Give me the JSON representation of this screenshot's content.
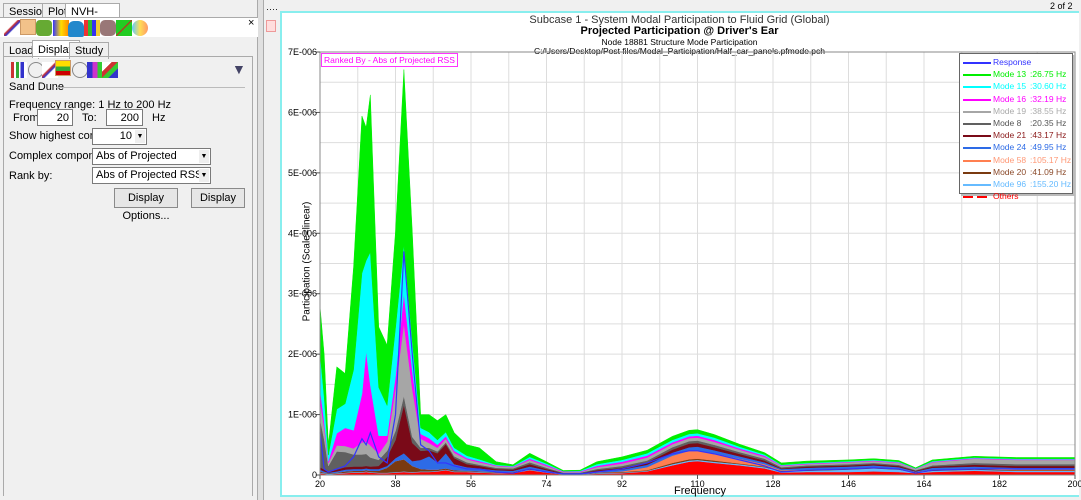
{
  "menu_tabs": [
    "Session",
    "Plot",
    "NVH-Utilities"
  ],
  "sub_tabs": [
    "Load",
    "Display",
    "Study"
  ],
  "panel": {
    "section": "Sand Dune",
    "freq_range": "Frequency range: 1 Hz to 200 Hz",
    "from_label": "From:",
    "from_value": "20",
    "to_label": "To:",
    "to_value": "200",
    "unit": "Hz",
    "highest_label": "Show highest contrib:",
    "highest_value": "10",
    "complex_label": "Complex component:",
    "complex_value": "Abs of Projected",
    "rank_label": "Rank by:",
    "rank_value": "Abs of Projected RSS",
    "display_options": "Display Options...",
    "display": "Display"
  },
  "page_indicator": "2 of 2",
  "chart_data": {
    "type": "area",
    "title": "Subcase 1 - System Modal Participation to Fluid Grid (Global)",
    "subtitle": "Projected Participation @ Driver's Ear",
    "subtitle2": "Node 18881 Structure Mode Participation",
    "file": "C:/Users/Desktop/Post files/Modal_Participation/Half_car_panels.pfmode.pch",
    "annotation": "Ranked By - Abs of Projected RSS",
    "xlabel": "Frequency",
    "ylabel": "Participation (Scale=linear)",
    "xlim": [
      20,
      200
    ],
    "ylim": [
      0,
      7e-06
    ],
    "y_unit_scale": 1e-07,
    "xticks": [
      "20",
      "38",
      "56",
      "74",
      "92",
      "110",
      "128",
      "146",
      "164",
      "182",
      "200"
    ],
    "yticks": [
      "0",
      "1E-006",
      "2E-006",
      "3E-006",
      "4E-006",
      "5E-006",
      "6E-006",
      "7E-006"
    ],
    "legend_position": "top-right",
    "x": [
      20,
      21,
      22,
      24,
      26,
      28,
      30,
      31,
      32,
      34,
      36,
      38,
      40,
      42,
      44,
      46,
      48,
      50,
      52,
      55,
      58,
      62,
      66,
      70,
      74,
      78,
      82,
      86,
      92,
      98,
      104,
      108,
      110,
      114,
      120,
      126,
      130,
      136,
      146,
      152,
      158,
      162,
      166,
      176,
      186,
      200
    ],
    "response": {
      "name": "Response",
      "color": "#3333ff",
      "values": [
        7,
        1,
        0.5,
        1,
        1.5,
        3,
        6,
        5,
        7,
        3,
        2,
        10,
        37,
        20,
        5,
        4,
        2,
        2,
        1.5,
        1,
        1,
        0.5,
        0.3,
        1,
        0.5,
        0.2,
        0.2,
        0.5,
        1,
        2,
        3.5,
        4,
        4,
        3.5,
        2.5,
        1.5,
        0.5,
        0.8,
        1,
        1.2,
        1,
        0.3,
        0.8,
        1,
        1,
        1
      ]
    },
    "series": [
      {
        "name": "Others",
        "freq": "",
        "color": "#ff0000",
        "values": [
          0.3,
          0.2,
          0.1,
          0.2,
          0.3,
          0.4,
          0.4,
          0.5,
          0.4,
          0.3,
          0.3,
          0.4,
          0.5,
          0.4,
          0.5,
          0.5,
          0.6,
          0.8,
          0.5,
          0.5,
          0.4,
          0.3,
          0.3,
          0.8,
          0.4,
          0.1,
          0.1,
          0.2,
          0.3,
          0.6,
          1.6,
          2.2,
          2.3,
          2.0,
          1.6,
          1.1,
          0.4,
          0.5,
          0.5,
          0.6,
          0.5,
          0.3,
          0.5,
          0.7,
          0.5,
          0.5
        ]
      },
      {
        "name": "Mode 96",
        "freq": ":155.20 Hz",
        "color": "#66bbff",
        "values": [
          0.1,
          0.1,
          0.1,
          0.1,
          0.1,
          0.1,
          0.1,
          0.1,
          0.1,
          0.1,
          0.1,
          0.1,
          0.1,
          0.1,
          0.1,
          0.1,
          0.1,
          0.1,
          0.1,
          0.1,
          0.1,
          0.1,
          0.1,
          0.1,
          0.1,
          0,
          0,
          0.1,
          0.1,
          0.1,
          0.2,
          0.2,
          0.2,
          0.2,
          0.2,
          0.2,
          0.2,
          0.2,
          0.4,
          0.5,
          0.4,
          0.1,
          0.2,
          0.2,
          0.2,
          0.2
        ]
      },
      {
        "name": "Mode 20",
        "freq": ":41.09 Hz",
        "color": "#7a3a10",
        "values": [
          0.2,
          0.1,
          0.1,
          0.1,
          0.2,
          0.2,
          0.2,
          0.2,
          0.2,
          0.3,
          0.8,
          1.8,
          2.0,
          1.0,
          0.4,
          0.3,
          0.2,
          0.2,
          0.2,
          0.1,
          0.1,
          0.1,
          0.1,
          0.2,
          0.1,
          0,
          0,
          0.1,
          0.1,
          0.1,
          0.2,
          0.2,
          0.2,
          0.2,
          0.1,
          0.1,
          0.1,
          0.1,
          0.1,
          0.1,
          0.1,
          0.1,
          0.1,
          0.1,
          0.1,
          0.1
        ]
      },
      {
        "name": "Mode 58",
        "freq": ":105.17 Hz",
        "color": "#ff7f50",
        "values": [
          0,
          0,
          0,
          0,
          0,
          0,
          0,
          0,
          0,
          0,
          0,
          0,
          0,
          0,
          0,
          0,
          0,
          0,
          0,
          0,
          0,
          0,
          0,
          0,
          0,
          0,
          0,
          0,
          0.1,
          0.5,
          1.2,
          1.4,
          1.4,
          1.2,
          0.8,
          0.4,
          0.1,
          0.1,
          0.1,
          0.1,
          0.1,
          0,
          0.1,
          0.1,
          0.1,
          0.1
        ]
      },
      {
        "name": "Mode 24",
        "freq": ":49.95 Hz",
        "color": "#2d6be6",
        "values": [
          0.3,
          0.2,
          0.1,
          0.2,
          0.3,
          0.3,
          0.3,
          0.3,
          0.3,
          0.3,
          0.3,
          0.5,
          1.0,
          0.8,
          1.5,
          2.2,
          1.2,
          2.5,
          1.0,
          0.6,
          0.5,
          0.3,
          0.2,
          0.3,
          0.2,
          0.1,
          0.1,
          0.2,
          0.3,
          0.4,
          0.5,
          0.6,
          0.6,
          0.5,
          0.4,
          0.3,
          0.2,
          0.3,
          0.3,
          0.3,
          0.2,
          0.1,
          0.3,
          0.3,
          0.3,
          0.3
        ]
      },
      {
        "name": "Mode 21",
        "freq": ":43.17 Hz",
        "color": "#7a0a18",
        "values": [
          0.4,
          0.3,
          0.1,
          0.3,
          0.4,
          0.4,
          0.4,
          0.4,
          0.4,
          0.5,
          1.5,
          3.0,
          8.0,
          3.0,
          1.5,
          1.0,
          1.5,
          1.5,
          1.0,
          0.5,
          0.4,
          0.2,
          0.2,
          0.4,
          0.2,
          0.1,
          0.1,
          0.2,
          0.3,
          0.4,
          0.5,
          0.6,
          0.6,
          0.5,
          0.4,
          0.3,
          0.1,
          0.2,
          0.2,
          0.2,
          0.2,
          0.1,
          0.2,
          0.3,
          0.3,
          0.3
        ]
      },
      {
        "name": "Mode 8",
        "freq": ":20.35 Hz",
        "color": "#606060",
        "values": [
          8,
          5,
          1,
          3,
          2.5,
          2,
          2,
          2,
          1.5,
          1,
          1,
          1.5,
          1.5,
          1,
          0.5,
          0.4,
          0.3,
          0.3,
          0.3,
          0.3,
          0.2,
          0.2,
          0.2,
          0.3,
          0.2,
          0.1,
          0.1,
          0.2,
          0.3,
          0.3,
          0.4,
          0.4,
          0.4,
          0.4,
          0.3,
          0.3,
          0.2,
          0.2,
          0.2,
          0.2,
          0.2,
          0.1,
          0.2,
          0.3,
          0.3,
          0.3
        ]
      },
      {
        "name": "Mode 19",
        "freq": ":38.55 Hz",
        "color": "#a6a6a6",
        "values": [
          3,
          2,
          0.5,
          1,
          1,
          1,
          2,
          2,
          2,
          1,
          1.5,
          7,
          12,
          8,
          1.5,
          0.8,
          0.6,
          0.6,
          0.6,
          0.5,
          0.4,
          0.3,
          0.2,
          0.4,
          0.3,
          0.1,
          0.1,
          0.3,
          0.4,
          0.5,
          0.5,
          0.5,
          0.5,
          0.5,
          0.4,
          0.3,
          0.2,
          0.2,
          0.3,
          0.3,
          0.3,
          0.2,
          0.5,
          0.7,
          0.7,
          0.7
        ]
      },
      {
        "name": "Mode 16",
        "freq": ":32.19 Hz",
        "color": "#ff00ff",
        "values": [
          2,
          1,
          0.3,
          2,
          3,
          3,
          8,
          15,
          10,
          3,
          1,
          2,
          5,
          3,
          0.8,
          0.8,
          0.5,
          0.4,
          0.3,
          0.2,
          0.2,
          0.1,
          0.1,
          0.2,
          0.2,
          0.1,
          0.1,
          0.2,
          0.3,
          0.3,
          0.3,
          0.3,
          0.3,
          0.3,
          0.2,
          0.2,
          0.1,
          0.1,
          0.1,
          0.1,
          0.1,
          0.05,
          0.1,
          0.1,
          0.1,
          0.1
        ]
      },
      {
        "name": "Mode 15",
        "freq": ":30.60 Hz",
        "color": "#00ffff",
        "values": [
          6,
          4,
          1,
          4,
          4,
          10,
          20,
          15,
          22,
          8,
          5,
          8,
          8,
          5,
          1,
          1,
          0.8,
          0.7,
          0.5,
          0.4,
          0.3,
          0.1,
          0.1,
          0.3,
          0.2,
          0.05,
          0.1,
          0.3,
          0.3,
          0.4,
          0.4,
          0.4,
          0.4,
          0.4,
          0.3,
          0.2,
          0.1,
          0.1,
          0.1,
          0.1,
          0.1,
          0.05,
          0.1,
          0.1,
          0.1,
          0.1
        ]
      },
      {
        "name": "Mode 13",
        "freq": ":26.75 Hz",
        "color": "#00ee00",
        "values": [
          7.7,
          7,
          1.7,
          7,
          5,
          17,
          26,
          22,
          26,
          10,
          10,
          16,
          29,
          18,
          2.2,
          2.9,
          3.2,
          2.9,
          2.5,
          1.8,
          1.9,
          0.5,
          0.2,
          0.6,
          0.3,
          0.1,
          0.1,
          0.4,
          0.5,
          0.5,
          0.6,
          0.6,
          0.6,
          0.5,
          0.4,
          0.3,
          0.3,
          0.3,
          0.2,
          0.2,
          0.2,
          0.1,
          0.2,
          0.2,
          0.2,
          0.2
        ]
      }
    ],
    "legend_order": [
      "Mode 13",
      "Mode 15",
      "Mode 16",
      "Mode 19",
      "Mode 8",
      "Mode 21",
      "Mode 24",
      "Mode 58",
      "Mode 20",
      "Mode 96",
      "Others"
    ],
    "legend_text_colors": {
      "Mode 19": "#aaaaaa",
      "Mode 8": "#555555",
      "Mode 21": "#8b1a1a",
      "Mode 20": "#8b4a2a",
      "Mode 96": "#66bbff",
      "Mode 58": "#ff9977"
    }
  }
}
